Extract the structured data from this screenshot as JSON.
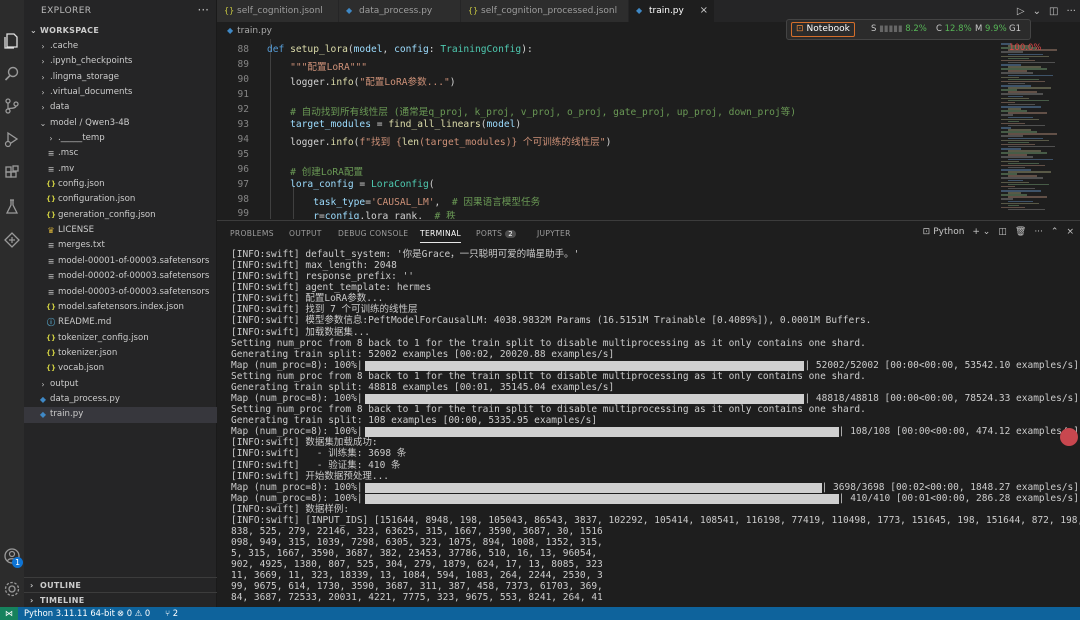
{
  "sidebar": {
    "title": "EXPLORER",
    "workspace_label": "WORKSPACE",
    "items": [
      {
        "label": ".cache",
        "type": "folder",
        "depth": 1
      },
      {
        "label": ".ipynb_checkpoints",
        "type": "folder",
        "depth": 1
      },
      {
        "label": ".lingma_storage",
        "type": "folder",
        "depth": 1
      },
      {
        "label": ".virtual_documents",
        "type": "folder",
        "depth": 1
      },
      {
        "label": "data",
        "type": "folder",
        "depth": 1
      },
      {
        "label": "model / Qwen3-4B",
        "type": "folder-open",
        "depth": 1
      },
      {
        "label": "._____temp",
        "type": "folder",
        "depth": 2
      },
      {
        "label": ".msc",
        "type": "file-lines",
        "depth": 2
      },
      {
        "label": ".mv",
        "type": "file-lines",
        "depth": 2
      },
      {
        "label": "config.json",
        "type": "json",
        "depth": 2
      },
      {
        "label": "configuration.json",
        "type": "json",
        "depth": 2
      },
      {
        "label": "generation_config.json",
        "type": "json",
        "depth": 2
      },
      {
        "label": "LICENSE",
        "type": "license",
        "depth": 2
      },
      {
        "label": "merges.txt",
        "type": "file-lines",
        "depth": 2
      },
      {
        "label": "model-00001-of-00003.safetensors",
        "type": "file-lines",
        "depth": 2
      },
      {
        "label": "model-00002-of-00003.safetensors",
        "type": "file-lines",
        "depth": 2
      },
      {
        "label": "model-00003-of-00003.safetensors",
        "type": "file-lines",
        "depth": 2
      },
      {
        "label": "model.safetensors.index.json",
        "type": "json",
        "depth": 2
      },
      {
        "label": "README.md",
        "type": "info",
        "depth": 2
      },
      {
        "label": "tokenizer_config.json",
        "type": "json",
        "depth": 2
      },
      {
        "label": "tokenizer.json",
        "type": "json",
        "depth": 2
      },
      {
        "label": "vocab.json",
        "type": "json",
        "depth": 2
      },
      {
        "label": "output",
        "type": "folder",
        "depth": 1
      },
      {
        "label": "data_process.py",
        "type": "python",
        "depth": 1
      },
      {
        "label": "train.py",
        "type": "python",
        "depth": 1
      }
    ],
    "outline_label": "OUTLINE",
    "timeline_label": "TIMELINE"
  },
  "tabs": [
    {
      "label": "self_cognition.jsonl",
      "icon": "{}"
    },
    {
      "label": "data_process.py",
      "icon": "py"
    },
    {
      "label": "self_cognition_processed.jsonl",
      "icon": "{}"
    },
    {
      "label": "train.py",
      "icon": "py",
      "active": true
    }
  ],
  "breadcrumb": {
    "file": "train.py"
  },
  "notebook_widget": {
    "button_label": "Notebook",
    "stats": [
      {
        "key": "S",
        "value": "8.2%"
      },
      {
        "key": "C",
        "value": "12.8%"
      },
      {
        "key": "M",
        "value": "9.9%"
      },
      {
        "key": "G1",
        "value": "100.0%"
      }
    ]
  },
  "editor": {
    "line_numbers": [
      "88",
      "89",
      "90",
      "91",
      "92",
      "93",
      "94",
      "95",
      "96",
      "97",
      "98",
      "99"
    ],
    "lines": [
      "def setup_lora(model, config: TrainingConfig):",
      "    \"\"\"配置LoRA\"\"\"",
      "    logger.info(\"配置LoRA参数...\")",
      "",
      "    # 自动找到所有线性层 (通常是q_proj, k_proj, v_proj, o_proj, gate_proj, up_proj, down_proj等)",
      "    target_modules = find_all_linears(model)",
      "    logger.info(f\"找到 {len(target_modules)} 个可训练的线性层\")",
      "",
      "    # 创建LoRA配置",
      "    lora_config = LoraConfig(",
      "        task_type='CAUSAL_LM',  # 因果语言模型任务",
      "        r=config.lora_rank,  # 秩"
    ]
  },
  "panel": {
    "tabs": [
      {
        "label": "PROBLEMS"
      },
      {
        "label": "OUTPUT"
      },
      {
        "label": "DEBUG CONSOLE"
      },
      {
        "label": "TERMINAL",
        "active": true
      },
      {
        "label": "PORTS",
        "count": "2"
      },
      {
        "label": "JUPYTER"
      }
    ],
    "shell_label": "Python",
    "terminal": [
      {
        "text": "[INFO:swift] default_system: '你是Grace，一只聪明可爱的喵星助手。'"
      },
      {
        "text": "[INFO:swift] max_length: 2048"
      },
      {
        "text": "[INFO:swift] response_prefix: ''"
      },
      {
        "text": "[INFO:swift] agent_template: hermes"
      },
      {
        "text": "[INFO:swift] 配置LoRA参数..."
      },
      {
        "text": "[INFO:swift] 找到 7 个可训练的线性层"
      },
      {
        "text": "[INFO:swift] 模型参数信息:PeftModelForCausalLM: 4038.9832M Params (16.5151M Trainable [0.4089%]), 0.0001M Buffers."
      },
      {
        "text": "[INFO:swift] 加载数据集..."
      },
      {
        "text": "Setting num_proc from 8 back to 1 for the train split to disable multiprocessing as it only contains one shard."
      },
      {
        "text": "Generating train split: 52002 examples [00:02, 20020.88 examples/s]"
      },
      {
        "text": "Map (num_proc=8): 100%|",
        "bar": 1.0,
        "suffix": "| 52002/52002 [00:00<00:00, 53542.10 examples/s]"
      },
      {
        "text": "Setting num_proc from 8 back to 1 for the train split to disable multiprocessing as it only contains one shard."
      },
      {
        "text": "Generating train split: 48818 examples [00:01, 35145.04 examples/s]"
      },
      {
        "text": "Map (num_proc=8): 100%|",
        "bar": 1.0,
        "suffix": "| 48818/48818 [00:00<00:00, 78524.33 examples/s]"
      },
      {
        "text": "Setting num_proc from 8 back to 1 for the train split to disable multiprocessing as it only contains one shard."
      },
      {
        "text": "Generating train split: 108 examples [00:00, 5335.95 examples/s]"
      },
      {
        "text": "Map (num_proc=8): 100%|",
        "bar": 1.0,
        "suffix": "| 108/108 [00:00<00:00, 474.12 examples/s]"
      },
      {
        "text": "[INFO:swift] 数据集加载成功:"
      },
      {
        "text": "[INFO:swift]   - 训练集: 3698 条"
      },
      {
        "text": "[INFO:swift]   - 验证集: 410 条"
      },
      {
        "text": "[INFO:swift] 开始数据预处理..."
      },
      {
        "text": "Map (num_proc=8): 100%|",
        "bar": 1.0,
        "suffix": "| 3698/3698 [00:02<00:00, 1848.27 examples/s]"
      },
      {
        "text": "Map (num_proc=8): 100%|",
        "bar": 1.0,
        "suffix": "| 410/410 [00:01<00:00, 286.28 examples/s]"
      },
      {
        "text": "[INFO:swift] 数据样例:"
      },
      {
        "text": "[INFO:swift] [INPUT_IDS] [151644, 8948, 198, 105043, 86543, 3837, 102292, 105414, 108541, 116198, 77419, 110498, 1773, 151645, 198, 151644, 872, 198, 3"
      },
      {
        "text": "838, 525, 279, 22146, 323, 63625, 315, 1667, 3590, 3687, 30, 1516"
      },
      {
        "text": "098, 949, 315, 1039, 7298, 6305, 323, 1075, 894, 1008, 1352, 315,"
      },
      {
        "text": "5, 315, 1667, 3590, 3687, 382, 23453, 37786, 510, 16, 13, 96054,"
      },
      {
        "text": "902, 4925, 1380, 807, 525, 304, 279, 1879, 624, 17, 13, 8085, 323"
      },
      {
        "text": "11, 3669, 11, 323, 18339, 13, 1084, 594, 1083, 264, 2244, 2530, 3"
      },
      {
        "text": "99, 9675, 614, 1730, 3590, 3687, 311, 387, 458, 7373, 61703, 369,"
      },
      {
        "text": "84, 3687, 72533, 20031, 4221, 7775, 323, 9675, 553, 8241, 264, 41"
      }
    ]
  },
  "statusbar": {
    "python": "Python 3.11.11 64-bit",
    "errors": "0",
    "warnings": "0",
    "ports": "2"
  }
}
